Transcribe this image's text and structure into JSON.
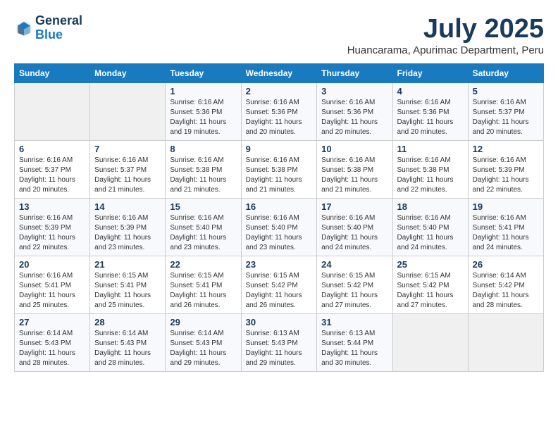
{
  "header": {
    "logo_line1": "General",
    "logo_line2": "Blue",
    "month": "July 2025",
    "location": "Huancarama, Apurimac Department, Peru"
  },
  "days_of_week": [
    "Sunday",
    "Monday",
    "Tuesday",
    "Wednesday",
    "Thursday",
    "Friday",
    "Saturday"
  ],
  "weeks": [
    [
      {
        "day": "",
        "info": ""
      },
      {
        "day": "",
        "info": ""
      },
      {
        "day": "1",
        "info": "Sunrise: 6:16 AM\nSunset: 5:36 PM\nDaylight: 11 hours and 19 minutes."
      },
      {
        "day": "2",
        "info": "Sunrise: 6:16 AM\nSunset: 5:36 PM\nDaylight: 11 hours and 20 minutes."
      },
      {
        "day": "3",
        "info": "Sunrise: 6:16 AM\nSunset: 5:36 PM\nDaylight: 11 hours and 20 minutes."
      },
      {
        "day": "4",
        "info": "Sunrise: 6:16 AM\nSunset: 5:36 PM\nDaylight: 11 hours and 20 minutes."
      },
      {
        "day": "5",
        "info": "Sunrise: 6:16 AM\nSunset: 5:37 PM\nDaylight: 11 hours and 20 minutes."
      }
    ],
    [
      {
        "day": "6",
        "info": "Sunrise: 6:16 AM\nSunset: 5:37 PM\nDaylight: 11 hours and 20 minutes."
      },
      {
        "day": "7",
        "info": "Sunrise: 6:16 AM\nSunset: 5:37 PM\nDaylight: 11 hours and 21 minutes."
      },
      {
        "day": "8",
        "info": "Sunrise: 6:16 AM\nSunset: 5:38 PM\nDaylight: 11 hours and 21 minutes."
      },
      {
        "day": "9",
        "info": "Sunrise: 6:16 AM\nSunset: 5:38 PM\nDaylight: 11 hours and 21 minutes."
      },
      {
        "day": "10",
        "info": "Sunrise: 6:16 AM\nSunset: 5:38 PM\nDaylight: 11 hours and 21 minutes."
      },
      {
        "day": "11",
        "info": "Sunrise: 6:16 AM\nSunset: 5:38 PM\nDaylight: 11 hours and 22 minutes."
      },
      {
        "day": "12",
        "info": "Sunrise: 6:16 AM\nSunset: 5:39 PM\nDaylight: 11 hours and 22 minutes."
      }
    ],
    [
      {
        "day": "13",
        "info": "Sunrise: 6:16 AM\nSunset: 5:39 PM\nDaylight: 11 hours and 22 minutes."
      },
      {
        "day": "14",
        "info": "Sunrise: 6:16 AM\nSunset: 5:39 PM\nDaylight: 11 hours and 23 minutes."
      },
      {
        "day": "15",
        "info": "Sunrise: 6:16 AM\nSunset: 5:40 PM\nDaylight: 11 hours and 23 minutes."
      },
      {
        "day": "16",
        "info": "Sunrise: 6:16 AM\nSunset: 5:40 PM\nDaylight: 11 hours and 23 minutes."
      },
      {
        "day": "17",
        "info": "Sunrise: 6:16 AM\nSunset: 5:40 PM\nDaylight: 11 hours and 24 minutes."
      },
      {
        "day": "18",
        "info": "Sunrise: 6:16 AM\nSunset: 5:40 PM\nDaylight: 11 hours and 24 minutes."
      },
      {
        "day": "19",
        "info": "Sunrise: 6:16 AM\nSunset: 5:41 PM\nDaylight: 11 hours and 24 minutes."
      }
    ],
    [
      {
        "day": "20",
        "info": "Sunrise: 6:16 AM\nSunset: 5:41 PM\nDaylight: 11 hours and 25 minutes."
      },
      {
        "day": "21",
        "info": "Sunrise: 6:15 AM\nSunset: 5:41 PM\nDaylight: 11 hours and 25 minutes."
      },
      {
        "day": "22",
        "info": "Sunrise: 6:15 AM\nSunset: 5:41 PM\nDaylight: 11 hours and 26 minutes."
      },
      {
        "day": "23",
        "info": "Sunrise: 6:15 AM\nSunset: 5:42 PM\nDaylight: 11 hours and 26 minutes."
      },
      {
        "day": "24",
        "info": "Sunrise: 6:15 AM\nSunset: 5:42 PM\nDaylight: 11 hours and 27 minutes."
      },
      {
        "day": "25",
        "info": "Sunrise: 6:15 AM\nSunset: 5:42 PM\nDaylight: 11 hours and 27 minutes."
      },
      {
        "day": "26",
        "info": "Sunrise: 6:14 AM\nSunset: 5:42 PM\nDaylight: 11 hours and 28 minutes."
      }
    ],
    [
      {
        "day": "27",
        "info": "Sunrise: 6:14 AM\nSunset: 5:43 PM\nDaylight: 11 hours and 28 minutes."
      },
      {
        "day": "28",
        "info": "Sunrise: 6:14 AM\nSunset: 5:43 PM\nDaylight: 11 hours and 28 minutes."
      },
      {
        "day": "29",
        "info": "Sunrise: 6:14 AM\nSunset: 5:43 PM\nDaylight: 11 hours and 29 minutes."
      },
      {
        "day": "30",
        "info": "Sunrise: 6:13 AM\nSunset: 5:43 PM\nDaylight: 11 hours and 29 minutes."
      },
      {
        "day": "31",
        "info": "Sunrise: 6:13 AM\nSunset: 5:44 PM\nDaylight: 11 hours and 30 minutes."
      },
      {
        "day": "",
        "info": ""
      },
      {
        "day": "",
        "info": ""
      }
    ]
  ]
}
